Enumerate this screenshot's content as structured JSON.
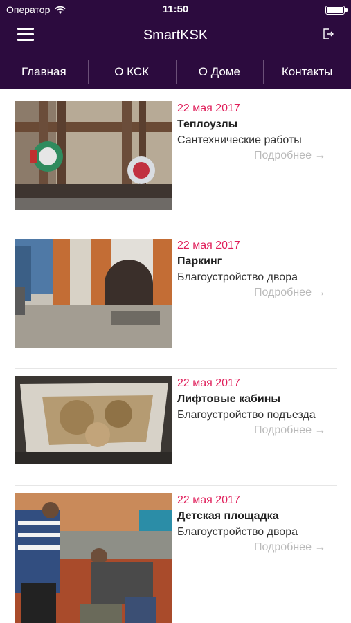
{
  "status": {
    "carrier": "Оператор",
    "time": "11:50"
  },
  "nav": {
    "title": "SmartKSK"
  },
  "tabs": [
    "Главная",
    "О КСК",
    "О Доме",
    "Контакты"
  ],
  "news": [
    {
      "date": "22 мая 2017",
      "title": "Теплоузлы",
      "category": "Сантехнические работы",
      "more": "Подробнее →"
    },
    {
      "date": "22 мая 2017",
      "title": "Паркинг",
      "category": "Благоустройство двора",
      "more": "Подробнее →"
    },
    {
      "date": "22 мая 2017",
      "title": "Лифтовые кабины",
      "category": "Благоустройство подъезда",
      "more": "Подробнее →"
    },
    {
      "date": "22 мая 2017",
      "title": "Детская площадка",
      "category": "Благоустройство двора",
      "more": "Подробнее →"
    }
  ],
  "colors": {
    "header": "#2c0b3e",
    "date": "#e01e5a",
    "more": "#b9b9b9"
  }
}
